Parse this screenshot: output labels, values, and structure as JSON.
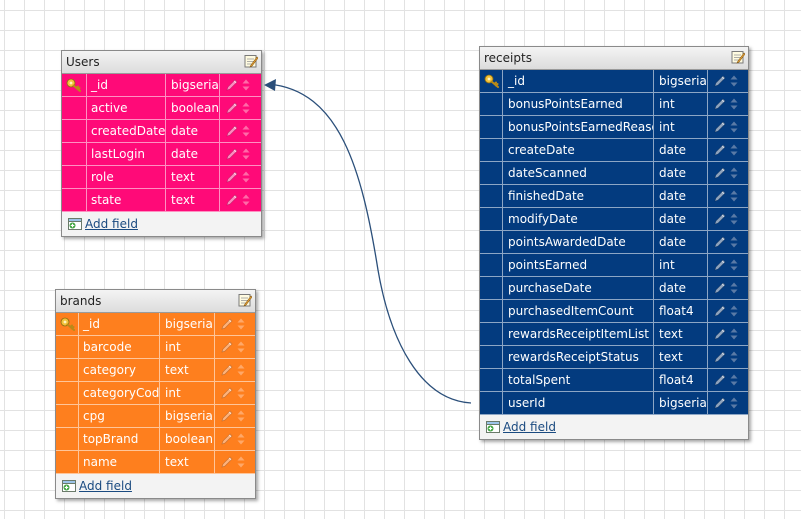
{
  "tables": [
    {
      "id": "users",
      "title": "Users",
      "fields": [
        {
          "name": "_id",
          "type": "bigserial",
          "primary_key": true
        },
        {
          "name": "active",
          "type": "boolean"
        },
        {
          "name": "createdDate",
          "type": "date"
        },
        {
          "name": "lastLogin",
          "type": "date"
        },
        {
          "name": "role",
          "type": "text"
        },
        {
          "name": "state",
          "type": "text"
        }
      ],
      "add_field_label": "Add field"
    },
    {
      "id": "brands",
      "title": "brands",
      "fields": [
        {
          "name": "_id",
          "type": "bigserial",
          "primary_key": true
        },
        {
          "name": "barcode",
          "type": "int"
        },
        {
          "name": "category",
          "type": "text"
        },
        {
          "name": "categoryCode",
          "type": "int"
        },
        {
          "name": "cpg",
          "type": "bigserial"
        },
        {
          "name": "topBrand",
          "type": "boolean"
        },
        {
          "name": "name",
          "type": "text"
        }
      ],
      "add_field_label": "Add field"
    },
    {
      "id": "receipts",
      "title": "receipts",
      "fields": [
        {
          "name": "_id",
          "type": "bigserial",
          "primary_key": true
        },
        {
          "name": "bonusPointsEarned",
          "type": "int"
        },
        {
          "name": "bonusPointsEarnedReason",
          "type": "int"
        },
        {
          "name": "createDate",
          "type": "date"
        },
        {
          "name": "dateScanned",
          "type": "date"
        },
        {
          "name": "finishedDate",
          "type": "date"
        },
        {
          "name": "modifyDate",
          "type": "date"
        },
        {
          "name": "pointsAwardedDate",
          "type": "date"
        },
        {
          "name": "pointsEarned",
          "type": "int"
        },
        {
          "name": "purchaseDate",
          "type": "date"
        },
        {
          "name": "purchasedItemCount",
          "type": "float4"
        },
        {
          "name": "rewardsReceiptItemList",
          "type": "text"
        },
        {
          "name": "rewardsReceiptStatus",
          "type": "text"
        },
        {
          "name": "totalSpent",
          "type": "float4"
        },
        {
          "name": "userId",
          "type": "bigserial"
        }
      ],
      "add_field_label": "Add field"
    }
  ],
  "relations": [
    {
      "from_table": "receipts",
      "from_field": "userId",
      "to_table": "users",
      "to_field": "_id"
    }
  ],
  "colors": {
    "users": "#ff0a78",
    "brands": "#fe7f1e",
    "receipts": "#033b7f",
    "relation_line": "#2b4f7a",
    "link": "#1a4a80"
  },
  "icons": {
    "primary_key": "key-icon",
    "edit_field": "pencil-icon",
    "reorder_field": "up-down-arrows-icon",
    "edit_table": "notepad-edit-icon",
    "add_field": "table-add-icon"
  }
}
